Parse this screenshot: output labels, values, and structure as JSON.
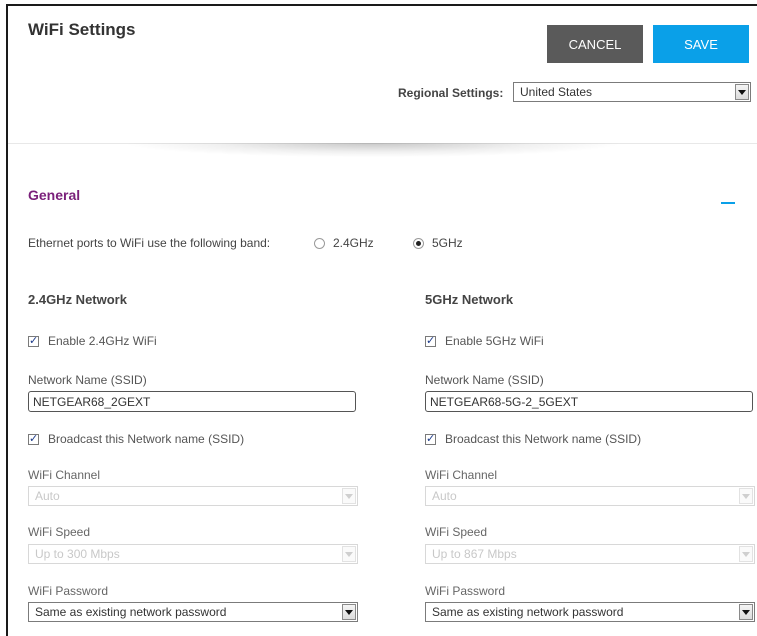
{
  "page": {
    "title": "WiFi Settings"
  },
  "actions": {
    "cancel_label": "CANCEL",
    "save_label": "SAVE"
  },
  "regional": {
    "label": "Regional Settings:",
    "value": "United States"
  },
  "general": {
    "title": "General",
    "band_label": "Ethernet ports to WiFi use the following band:",
    "band_options": [
      {
        "label": "2.4GHz",
        "checked": false
      },
      {
        "label": "5GHz",
        "checked": true
      }
    ]
  },
  "networks": [
    {
      "title": "2.4GHz Network",
      "enable_label": "Enable 2.4GHz WiFi",
      "ssid_label": "Network Name (SSID)",
      "ssid_value": "NETGEAR68_2GEXT",
      "broadcast_label": "Broadcast this Network name (SSID)",
      "channel_label": "WiFi Channel",
      "channel_value": "Auto",
      "speed_label": "WiFi Speed",
      "speed_value": "Up to 300 Mbps",
      "password_label": "WiFi Password",
      "password_value": "Same as existing network password"
    },
    {
      "title": "5GHz Network",
      "enable_label": "Enable 5GHz WiFi",
      "ssid_label": "Network Name (SSID)",
      "ssid_value": "NETGEAR68-5G-2_5GEXT",
      "broadcast_label": "Broadcast this Network name (SSID)",
      "channel_label": "WiFi Channel",
      "channel_value": "Auto",
      "speed_label": "WiFi Speed",
      "speed_value": "Up to 867 Mbps",
      "password_label": "WiFi Password",
      "password_value": "Same as existing network password"
    }
  ],
  "colors": {
    "accent": "#0aa0e8",
    "section_title": "#7a1f7a",
    "cancel": "#5a5a5a"
  }
}
